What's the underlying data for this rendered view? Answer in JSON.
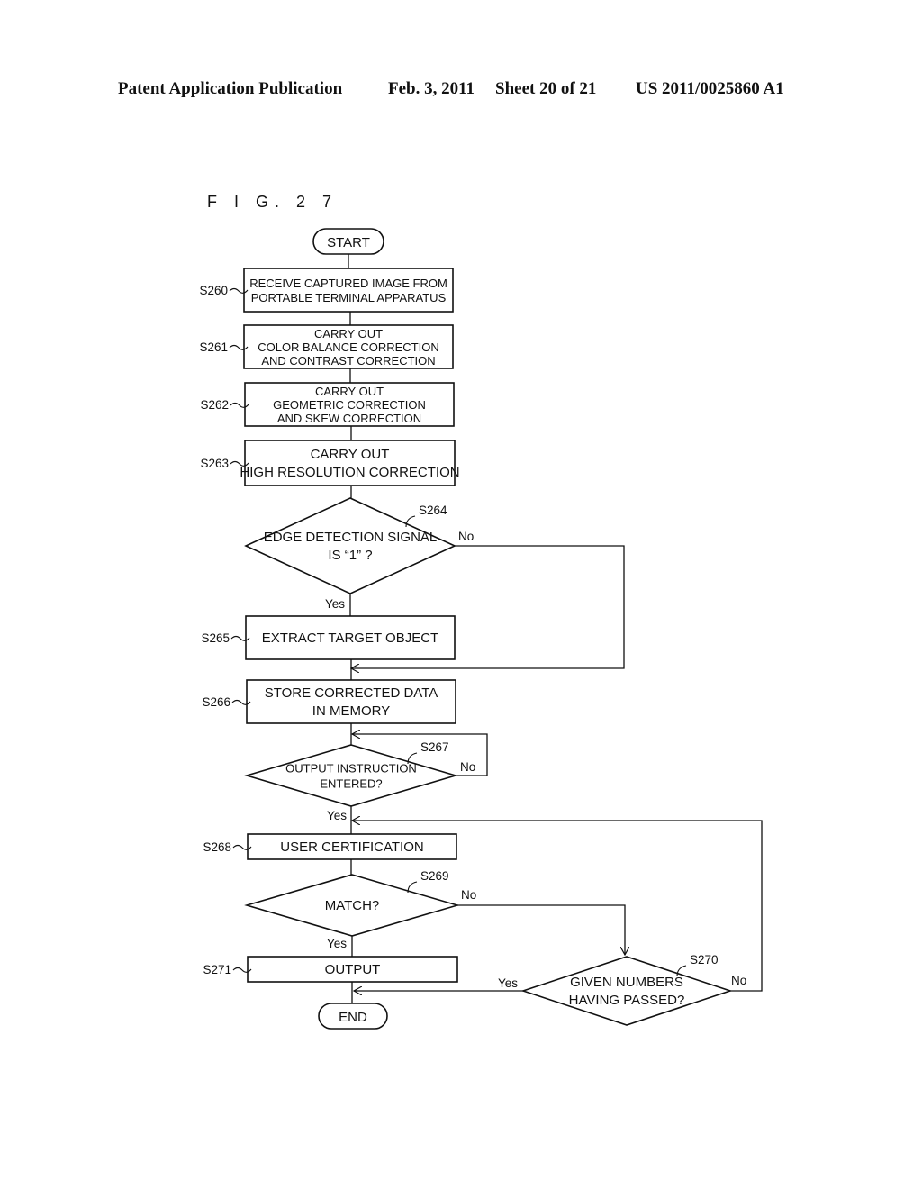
{
  "header": {
    "publication": "Patent Application Publication",
    "date": "Feb. 3, 2011",
    "sheet": "Sheet 20 of 21",
    "number": "US 2011/0025860 A1"
  },
  "figure": {
    "label": "F I G. 2 7"
  },
  "flowchart": {
    "start": "START",
    "end": "END",
    "steps": [
      {
        "id": "S260",
        "lines": [
          "RECEIVE  CAPTURED IMAGE FROM",
          "PORTABLE TERMINAL APPARATUS"
        ]
      },
      {
        "id": "S261",
        "lines": [
          "CARRY OUT",
          "COLOR BALANCE CORRECTION",
          "AND CONTRAST CORRECTION"
        ]
      },
      {
        "id": "S262",
        "lines": [
          "CARRY OUT",
          "GEOMETRIC CORRECTION",
          "AND SKEW CORRECTION"
        ]
      },
      {
        "id": "S263",
        "lines": [
          "CARRY OUT",
          "HIGH RESOLUTION CORRECTION"
        ]
      },
      {
        "id": "S265",
        "lines": [
          "EXTRACT TARGET OBJECT"
        ]
      },
      {
        "id": "S266",
        "lines": [
          "STORE CORRECTED DATA",
          "IN MEMORY"
        ]
      },
      {
        "id": "S268",
        "lines": [
          "USER CERTIFICATION"
        ]
      },
      {
        "id": "S271",
        "lines": [
          "OUTPUT"
        ]
      }
    ],
    "decisions": [
      {
        "id": "S264",
        "lines": [
          "EDGE DETECTION SIGNAL",
          "IS “1” ?"
        ],
        "yes": "Yes",
        "no": "No"
      },
      {
        "id": "S267",
        "lines": [
          "OUTPUT INSTRUCTION",
          "ENTERED?"
        ],
        "yes": "Yes",
        "no": "No"
      },
      {
        "id": "S269",
        "lines": [
          "MATCH?"
        ],
        "yes": "Yes",
        "no": "No"
      },
      {
        "id": "S270",
        "lines": [
          "GIVEN NUMBERS",
          "HAVING PASSED?"
        ],
        "yes": "Yes",
        "no": "No"
      }
    ]
  }
}
